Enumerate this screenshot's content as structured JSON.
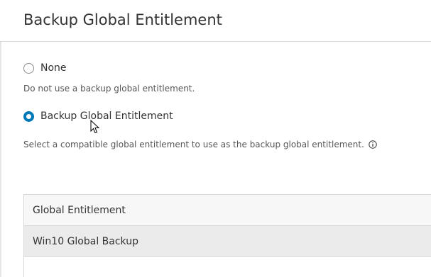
{
  "dialog": {
    "title": "Backup Global Entitlement"
  },
  "options": [
    {
      "label": "None",
      "checked": false,
      "description": "Do not use a backup global entitlement."
    },
    {
      "label": "Backup Global Entitlement",
      "checked": true,
      "description": "Select a compatible global entitlement to use as the backup global entitlement."
    }
  ],
  "table": {
    "columns": [
      "Global Entitlement"
    ],
    "rows": [
      [
        "Win10 Global Backup"
      ]
    ]
  },
  "icons": {
    "info": "info-icon",
    "cursor": "mouse-cursor-icon"
  },
  "colors": {
    "accent": "#0079b8",
    "selected_row": "#ebebeb"
  }
}
